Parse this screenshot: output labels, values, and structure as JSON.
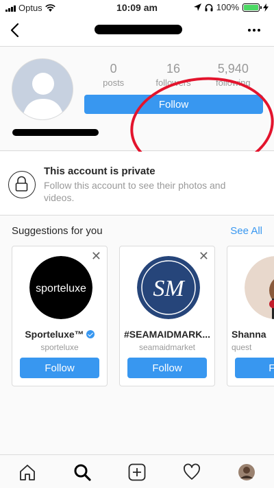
{
  "status_bar": {
    "carrier": "Optus",
    "time": "10:09 am",
    "battery": "100%",
    "battery_level": 1.0
  },
  "nav": {
    "back_icon": "chevron-left-icon",
    "more_icon": "more-horizontal-icon"
  },
  "profile": {
    "stats": [
      {
        "value": "0",
        "label": "posts"
      },
      {
        "value": "16",
        "label": "followers"
      },
      {
        "value": "5,940",
        "label": "following"
      }
    ],
    "follow_label": "Follow"
  },
  "private": {
    "title": "This account is private",
    "description": "Follow this account to see their photos and videos."
  },
  "suggestions": {
    "heading": "Suggestions for you",
    "see_all": "See All",
    "cards": [
      {
        "name": "Sporteluxe™",
        "handle": "sporteluxe",
        "button": "Follow",
        "verified": true,
        "logo_text": "sporteluxe"
      },
      {
        "name": "#SEAMAIDMARK...",
        "handle": "seamaidmarket",
        "button": "Follow",
        "verified": false,
        "logo_text": "SM"
      },
      {
        "name": "Shanna",
        "handle": "quest",
        "button": "Fo",
        "verified": false
      }
    ]
  },
  "tabbar": {
    "items": [
      "home-icon",
      "search-icon",
      "new-post-icon",
      "activity-heart-icon",
      "profile-avatar-icon"
    ]
  },
  "colors": {
    "accent": "#3897f0",
    "annotation": "#e3142d",
    "battery": "#4cd964"
  }
}
